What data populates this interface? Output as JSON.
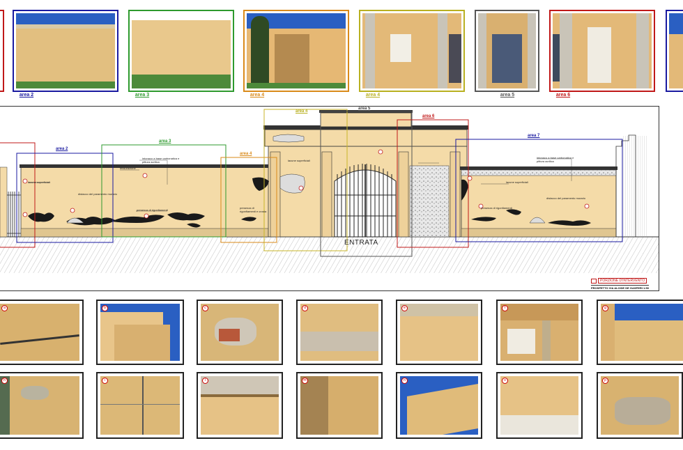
{
  "top_photos": [
    {
      "label": "",
      "color": "#1a1aa0"
    },
    {
      "label": "area 2",
      "color": "#1a1aa0"
    },
    {
      "label": "area 3",
      "color": "#2e9a2e"
    },
    {
      "label": "area 4",
      "color": "#d98a1a"
    },
    {
      "label": "area 4",
      "color": "#b8b020"
    },
    {
      "label": "area 5",
      "color": "#555555"
    },
    {
      "label": "area 6",
      "color": "#c01818"
    },
    {
      "label": "",
      "color": "#1a1aa0"
    }
  ],
  "drawing": {
    "area_labels": {
      "area2": "area 2",
      "area3": "area 3",
      "area4a": "area 4",
      "area4b": "area 4",
      "area5": "area 5",
      "area6": "area 6",
      "area7": "area 7"
    },
    "entrance_label": "ENTRATA",
    "legend": {
      "item": "PORZIONE D'INTERVENTO",
      "title": "PROSPETTO VIA ALCIDE DE GASPERI 1:50"
    },
    "notes": {
      "n1": "intonaco a base carbonatica e pittura acrilica",
      "n2": "fessurazione",
      "n3": "lacune superficiali",
      "n4": "distacco del paramento murario",
      "n5": "presenza di rigonfiamenti",
      "n6": "lacune superficiali",
      "n7": "presenza di rigonfiamenti e crosta",
      "n8": "intonaco a base carbonatica e pittura acrilica",
      "n9": "lacune superficiali",
      "n10": "distacco del paramento murario",
      "n11": "presenza di rigonfiamenti"
    }
  },
  "colors": {
    "area2": "#1a1aa0",
    "area3": "#2e9a2e",
    "area4a": "#d98a1a",
    "area4b": "#c8b628",
    "area5": "#555555",
    "area6": "#c01818",
    "area7": "#1a1aa0",
    "wall": "#f4dba8",
    "sky": "#2a5fc2"
  },
  "detail_rows": [
    [
      {
        "badge": "a"
      },
      {
        "badge": "b"
      },
      {
        "badge": "c"
      },
      {
        "badge": "d"
      },
      {
        "badge": "e"
      },
      {
        "badge": "f"
      },
      {
        "badge": "g"
      }
    ],
    [
      {
        "badge": "h"
      },
      {
        "badge": "i"
      },
      {
        "badge": "l"
      },
      {
        "badge": "m"
      },
      {
        "badge": "n"
      },
      {
        "badge": "o"
      },
      {
        "badge": "p"
      }
    ]
  ]
}
